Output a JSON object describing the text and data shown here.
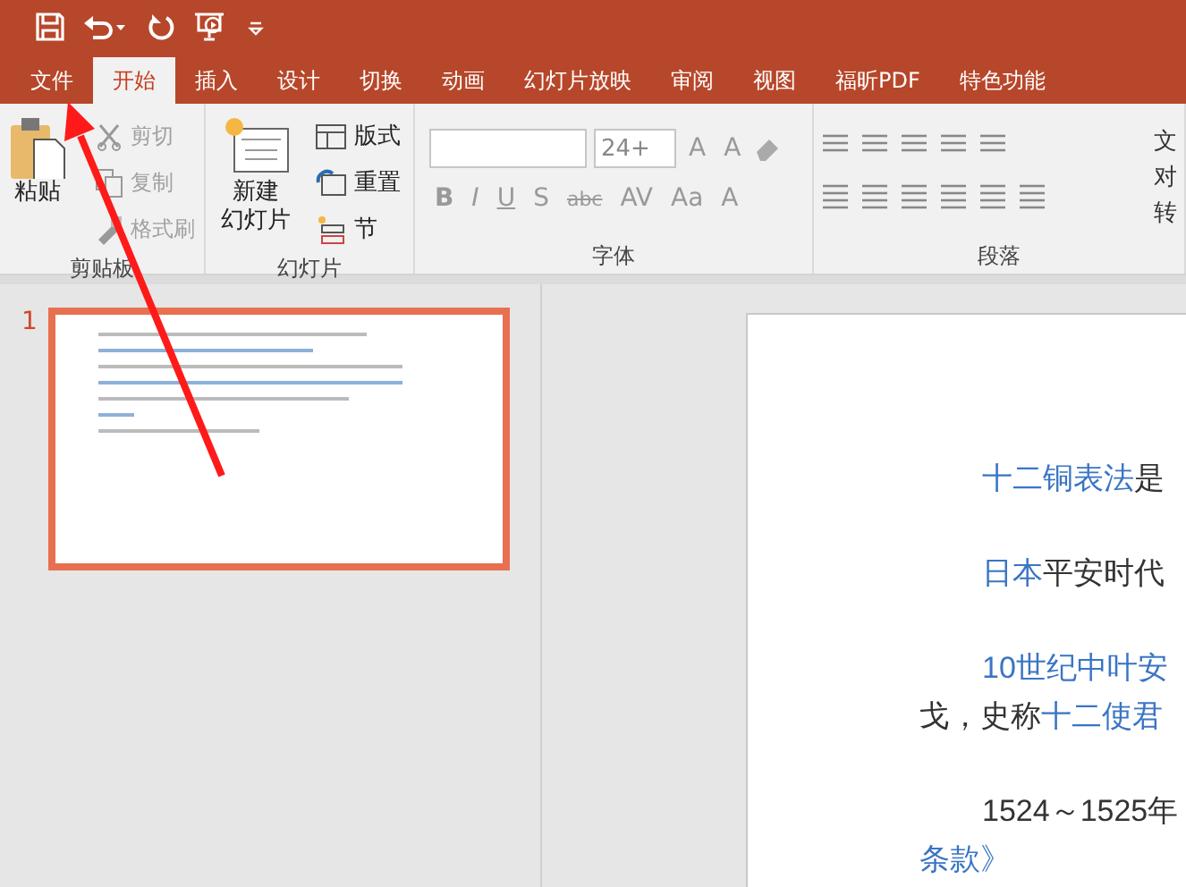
{
  "tabs": [
    {
      "label": "文件",
      "selected": false
    },
    {
      "label": "开始",
      "selected": true
    },
    {
      "label": "插入",
      "selected": false
    },
    {
      "label": "设计",
      "selected": false
    },
    {
      "label": "切换",
      "selected": false
    },
    {
      "label": "动画",
      "selected": false
    },
    {
      "label": "幻灯片放映",
      "selected": false
    },
    {
      "label": "审阅",
      "selected": false
    },
    {
      "label": "视图",
      "selected": false
    },
    {
      "label": "福昕PDF",
      "selected": false
    },
    {
      "label": "特色功能",
      "selected": false
    }
  ],
  "ribbon": {
    "clipboard": {
      "label": "剪贴板",
      "paste": "粘贴",
      "items": [
        {
          "label": "剪切",
          "disabled": true
        },
        {
          "label": "复制",
          "disabled": true
        },
        {
          "label": "格式刷",
          "disabled": true
        }
      ]
    },
    "slides": {
      "label": "幻灯片",
      "new_slide": [
        "新建",
        "幻灯片"
      ],
      "items": [
        {
          "label": "版式"
        },
        {
          "label": "重置"
        },
        {
          "label": "节"
        }
      ]
    },
    "font": {
      "label": "字体",
      "font_size": "24+",
      "size_buttons": [
        "A",
        "A"
      ],
      "format_buttons": [
        "B",
        "I",
        "U",
        "S",
        "abc",
        "AV",
        "Aa"
      ],
      "font_color": "A"
    },
    "paragraph": {
      "label": "段落",
      "edge_labels": [
        "文",
        "对",
        "转"
      ]
    }
  },
  "thumbnails": [
    {
      "number": "1",
      "selected": true
    }
  ],
  "slide": {
    "paragraphs": [
      {
        "indent": true,
        "segments": [
          {
            "text": "十二铜表法",
            "link": true
          },
          {
            "text": "是",
            "link": false
          }
        ]
      },
      {
        "indent": true,
        "segments": [
          {
            "text": "日本",
            "link": true
          },
          {
            "text": "平安时代",
            "link": false
          }
        ]
      },
      {
        "indent": true,
        "segments": [
          {
            "text": "10世纪中叶安",
            "link": true
          }
        ]
      },
      {
        "indent": false,
        "segments": [
          {
            "text": "戈，史称",
            "link": false
          },
          {
            "text": "十二使君",
            "link": true
          }
        ]
      },
      {
        "indent": true,
        "segments": [
          {
            "text": "1524～1525年",
            "link": false
          }
        ]
      },
      {
        "indent": false,
        "segments": [
          {
            "text": "条款》",
            "link": true
          }
        ]
      }
    ]
  }
}
